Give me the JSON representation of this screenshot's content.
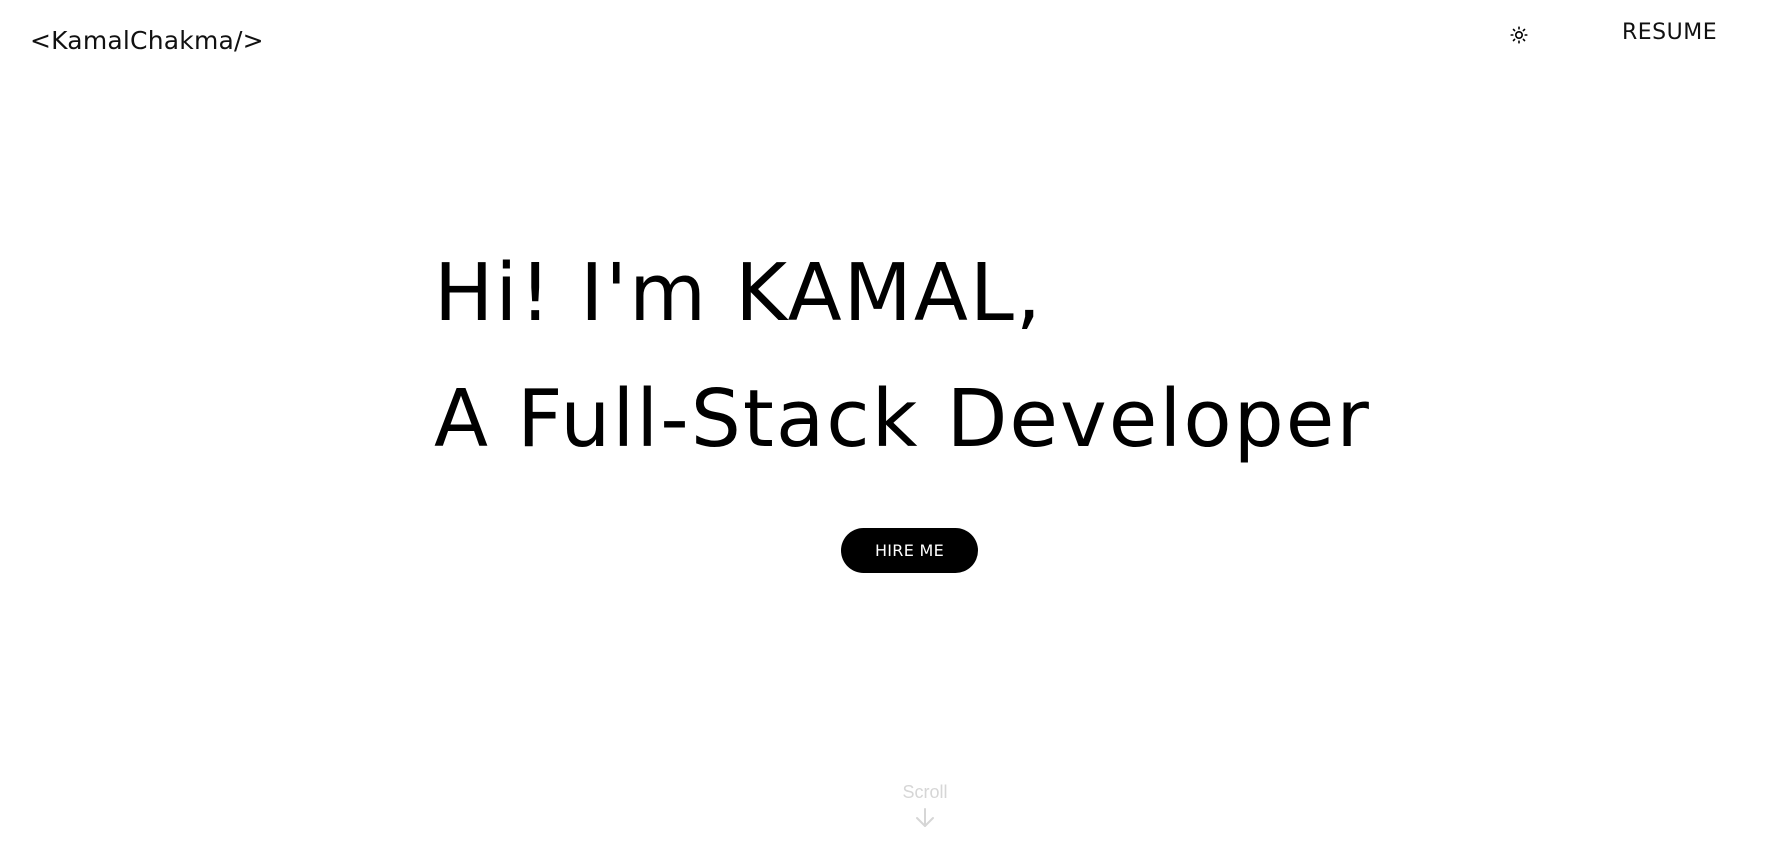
{
  "header": {
    "logo": "<KamalChakma/>",
    "theme_toggle_icon": "sun-icon",
    "resume_label": "RESUME"
  },
  "hero": {
    "line1": "Hi! I'm KAMAL,",
    "line2": "A Full-Stack Developer",
    "cta_label": "HIRE ME"
  },
  "scroll": {
    "label": "Scroll",
    "icon": "arrow-down-icon"
  },
  "colors": {
    "background": "#ffffff",
    "text": "#000000",
    "button_bg": "#000000",
    "button_text": "#ffffff",
    "scroll_text": "#d6d6d6"
  }
}
